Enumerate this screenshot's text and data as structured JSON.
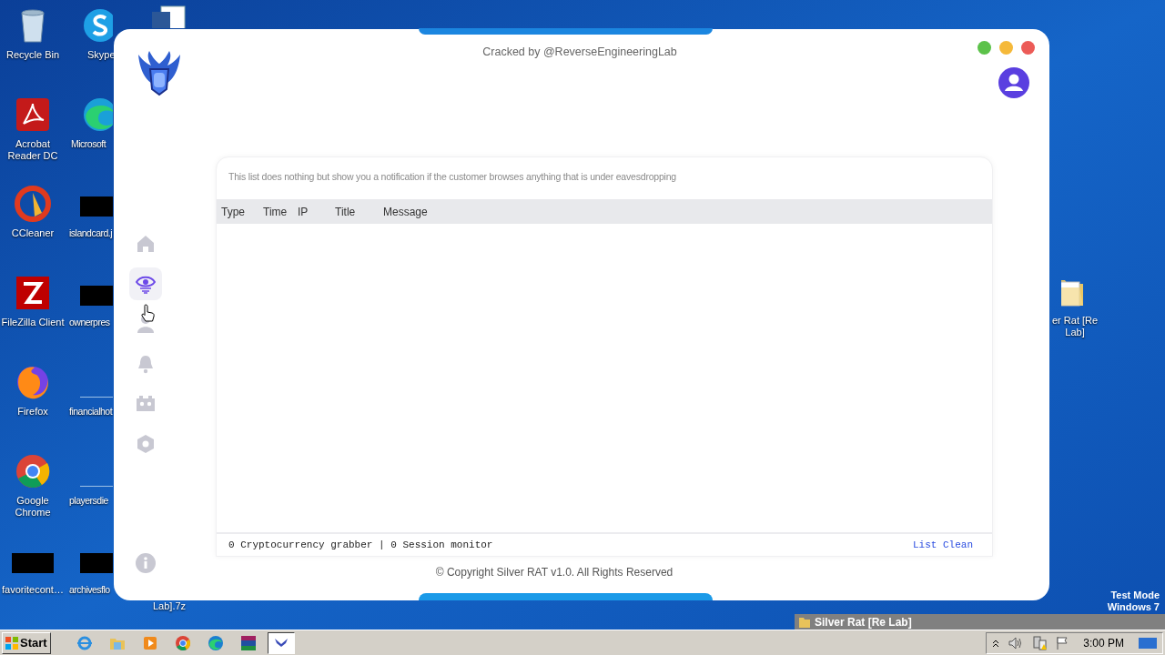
{
  "desktop": {
    "icons": [
      {
        "kind": "recycle",
        "lines": [
          "Recycle Bin"
        ]
      },
      {
        "kind": "skype",
        "lines": [
          "Skype"
        ]
      },
      {
        "kind": "word"
      },
      {
        "kind": "acrobat",
        "lines": [
          "Acrobat",
          "Reader DC"
        ]
      },
      {
        "kind": "edge",
        "lines": [
          "Microsoft"
        ]
      },
      {
        "kind": "ccleaner",
        "lines": [
          "CCleaner"
        ]
      },
      {
        "kind": "redacted",
        "lines": [
          "islandcard.j"
        ]
      },
      {
        "kind": "filezilla",
        "lines": [
          "FileZilla Client"
        ]
      },
      {
        "kind": "redacted",
        "lines": [
          "ownerpres"
        ]
      },
      {
        "kind": "firefox",
        "lines": [
          "Firefox"
        ]
      },
      {
        "kind": "blank",
        "lines": [
          "financialhot"
        ]
      },
      {
        "kind": "chrome",
        "lines": [
          "Google",
          "Chrome"
        ]
      },
      {
        "kind": "blank",
        "lines": [
          "playersdie"
        ]
      },
      {
        "kind": "redacted",
        "lines": [
          "favoritecont…"
        ]
      },
      {
        "kind": "redacted",
        "lines": [
          "archivesflo"
        ]
      },
      {
        "kind": "text",
        "lines": [
          "Lab].7z"
        ]
      },
      {
        "kind": "folder",
        "lines": [
          "er Rat [Re",
          "Lab]"
        ]
      }
    ],
    "os_notice": [
      "Test Mode",
      "Windows 7"
    ]
  },
  "window": {
    "title": "Cracked by @ReverseEngineeringLab",
    "sidebar": {
      "items": [
        {
          "kind": "home",
          "selected": false
        },
        {
          "kind": "eye",
          "selected": true
        },
        {
          "kind": "user",
          "selected": false
        },
        {
          "kind": "bell",
          "selected": false
        },
        {
          "kind": "robot",
          "selected": false
        },
        {
          "kind": "hexagon",
          "selected": false
        }
      ]
    },
    "notice": "This list does nothing but show you a notification if the customer browses anything that is under eavesdropping",
    "table": {
      "columns": [
        "Type",
        "Time",
        "IP",
        "Title",
        "Message"
      ]
    },
    "status": "0 Cryptocurrency grabber | 0 Session monitor",
    "link": "List Clean",
    "footer": "© Copyright Silver RAT v1.0. All Rights Reserved"
  },
  "taskbar": {
    "start": "Start",
    "quick_launch": [
      {
        "kind": "ie",
        "selected": false
      },
      {
        "kind": "explorer",
        "selected": false
      },
      {
        "kind": "media",
        "selected": false
      },
      {
        "kind": "chrome",
        "selected": false
      },
      {
        "kind": "edge",
        "selected": false
      },
      {
        "kind": "winrar",
        "selected": false
      },
      {
        "kind": "app",
        "selected": true
      }
    ],
    "window_button": "Silver Rat [Re Lab]",
    "clock": "3:00 PM"
  }
}
